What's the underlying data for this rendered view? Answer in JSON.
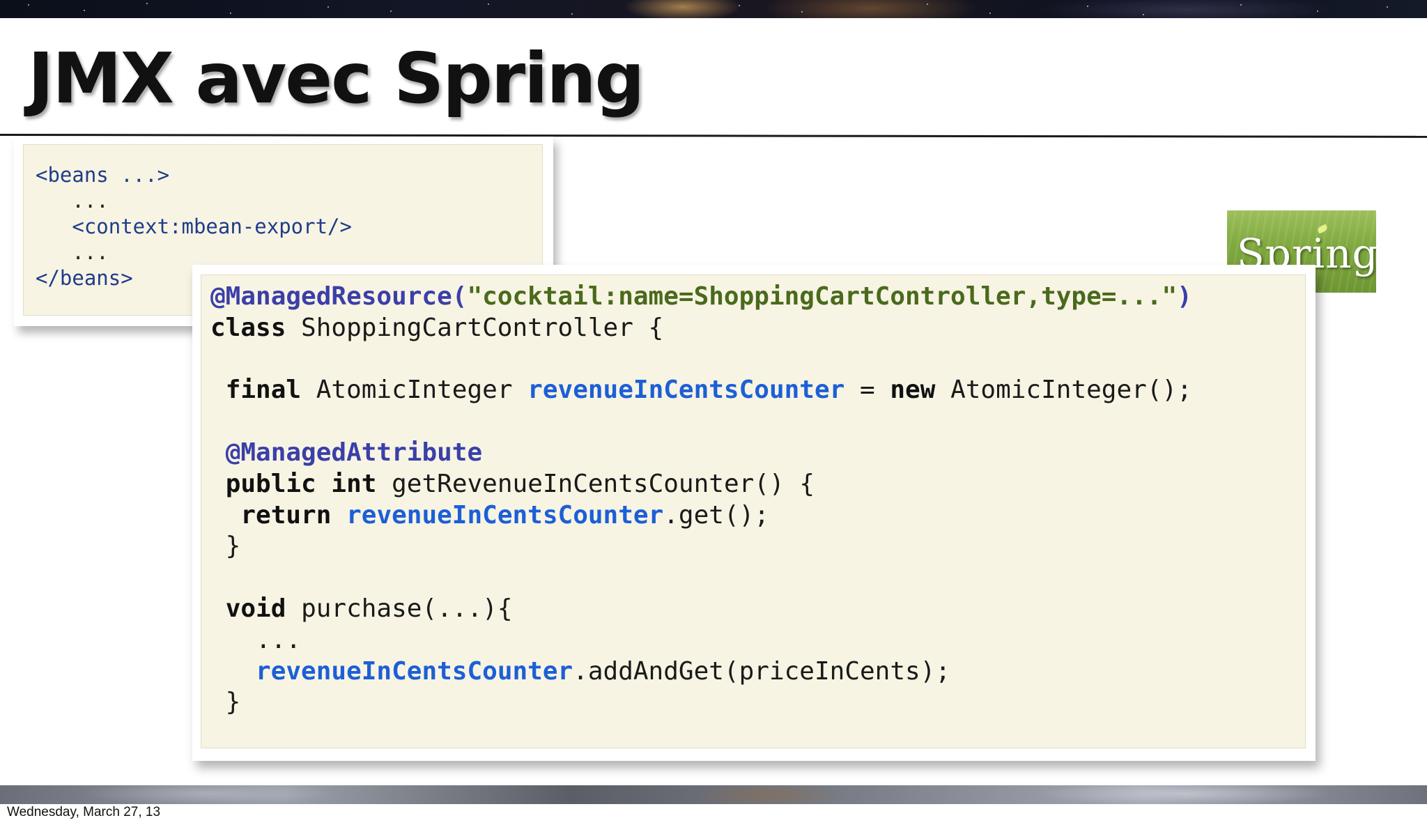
{
  "slide": {
    "title": "JMX avec Spring",
    "footer_date": "Wednesday, March 27, 13",
    "logo_text": "Spring",
    "logo_icon": "spring-leaf-logo"
  },
  "xml_code": {
    "lines": [
      "<beans ...>",
      "   ...",
      "   <context:mbean-export/>",
      "   ...",
      "</beans>"
    ]
  },
  "java_code": {
    "lines": [
      "@ManagedResource(\"cocktail:name=ShoppingCartController,type=...\")",
      "class ShoppingCartController {",
      "",
      " final AtomicInteger revenueInCentsCounter = new AtomicInteger();",
      "",
      " @ManagedAttribute",
      " public int getRevenueInCentsCounter() {",
      "  return revenueInCentsCounter.get();",
      " }",
      "",
      " void purchase(...){",
      "   ...",
      "   revenueInCentsCounter.addAndGet(priceInCents);",
      " }"
    ]
  },
  "colors": {
    "code_background": "#f7f4e4",
    "annotation": "#3b3fa8",
    "string_literal": "#4a6a1c",
    "field_highlight": "#1c5fd6",
    "xml_tag": "#1f3c88",
    "logo_green": "#7ea83e"
  }
}
